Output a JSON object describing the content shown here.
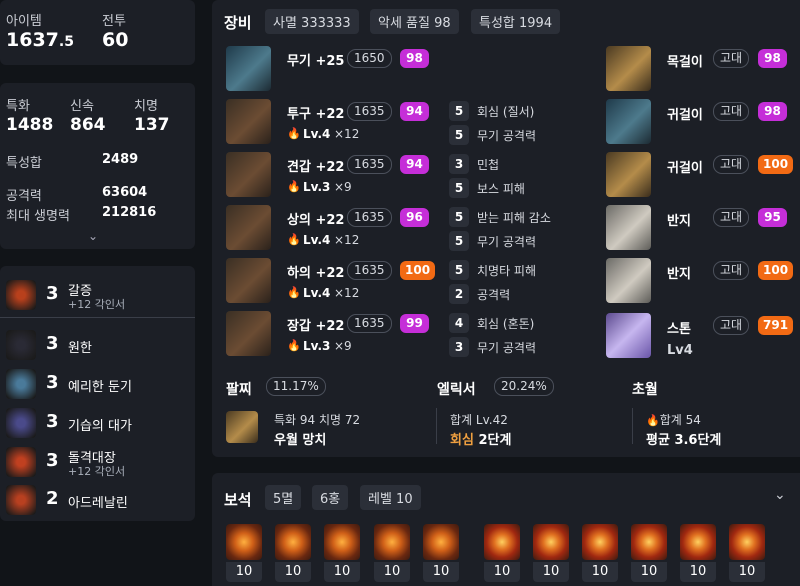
{
  "summary": {
    "item_label": "아이템",
    "item_int": "1637",
    "item_dec": ".5",
    "combat_label": "전투",
    "combat_value": "60"
  },
  "stats": {
    "crit_label": "특화",
    "crit_value": "1488",
    "swift_label": "신속",
    "swift_value": "864",
    "fatal_label": "치명",
    "fatal_value": "137",
    "total_label": "특성합",
    "total_value": "2489",
    "atk_label": "공격력",
    "atk_value": "63604",
    "hp_label": "최대 생명력",
    "hp_value": "212816"
  },
  "engravings": [
    {
      "level": "3",
      "name": "갈증",
      "sub": "+12 각인서"
    },
    {
      "level": "3",
      "name": "원한",
      "sub": ""
    },
    {
      "level": "3",
      "name": "예리한 둔기",
      "sub": ""
    },
    {
      "level": "3",
      "name": "기습의 대가",
      "sub": ""
    },
    {
      "level": "3",
      "name": "돌격대장",
      "sub": "+12 각인서"
    },
    {
      "level": "2",
      "name": "아드레날린",
      "sub": ""
    }
  ],
  "equipment": {
    "title": "장비",
    "tags": [
      "사멸 333333",
      "악세 품질 98",
      "특성합 1994"
    ],
    "gear": [
      {
        "name": "무기 +25",
        "ilvl": "1650",
        "quality": "98",
        "qcolor": "pink",
        "lv": "",
        "mult": "",
        "opts": []
      },
      {
        "name": "투구 +22",
        "ilvl": "1635",
        "quality": "94",
        "qcolor": "pink",
        "lv": "Lv.4",
        "mult": "×12",
        "opts": [
          [
            "5",
            "회심 (질서)"
          ],
          [
            "5",
            "무기 공격력"
          ]
        ]
      },
      {
        "name": "견갑 +22",
        "ilvl": "1635",
        "quality": "94",
        "qcolor": "pink",
        "lv": "Lv.3",
        "mult": "×9",
        "opts": [
          [
            "3",
            "민첩"
          ],
          [
            "5",
            "보스 피해"
          ]
        ]
      },
      {
        "name": "상의 +22",
        "ilvl": "1635",
        "quality": "96",
        "qcolor": "pink",
        "lv": "Lv.4",
        "mult": "×12",
        "opts": [
          [
            "5",
            "받는 피해 감소"
          ],
          [
            "5",
            "무기 공격력"
          ]
        ]
      },
      {
        "name": "하의 +22",
        "ilvl": "1635",
        "quality": "100",
        "qcolor": "orange",
        "lv": "Lv.4",
        "mult": "×12",
        "opts": [
          [
            "5",
            "치명타 피해"
          ],
          [
            "2",
            "공격력"
          ]
        ]
      },
      {
        "name": "장갑 +22",
        "ilvl": "1635",
        "quality": "99",
        "qcolor": "pink",
        "lv": "Lv.3",
        "mult": "×9",
        "opts": [
          [
            "4",
            "회심 (혼돈)"
          ],
          [
            "3",
            "무기 공격력"
          ]
        ]
      }
    ],
    "accessories": [
      {
        "name": "목걸이",
        "grade": "고대",
        "quality": "98",
        "qcolor": "pink"
      },
      {
        "name": "귀걸이",
        "grade": "고대",
        "quality": "98",
        "qcolor": "pink"
      },
      {
        "name": "귀걸이",
        "grade": "고대",
        "quality": "100",
        "qcolor": "orange"
      },
      {
        "name": "반지",
        "grade": "고대",
        "quality": "95",
        "qcolor": "pink"
      },
      {
        "name": "반지",
        "grade": "고대",
        "quality": "100",
        "qcolor": "orange"
      },
      {
        "name": "스톤",
        "grade": "고대",
        "quality": "791",
        "qcolor": "orange",
        "extra": "Lv4"
      }
    ],
    "bracelet": {
      "title": "팔찌",
      "pct": "11.17%",
      "line1": "특화 94  치명 72",
      "line2": "우월  망치"
    },
    "elixir": {
      "title": "엘릭서",
      "pct": "20.24%",
      "line1": "합계 Lv.42",
      "line2_a": "회심",
      "line2_b": "2단계"
    },
    "transcend": {
      "title": "초월",
      "line1": "합계 54",
      "line2": "평균 3.6단계"
    }
  },
  "gems": {
    "title": "보석",
    "tags": [
      "5멸",
      "6홍",
      "레벨 10"
    ],
    "levels": [
      "10",
      "10",
      "10",
      "10",
      "10",
      "10",
      "10",
      "10",
      "10",
      "10",
      "10"
    ]
  }
}
